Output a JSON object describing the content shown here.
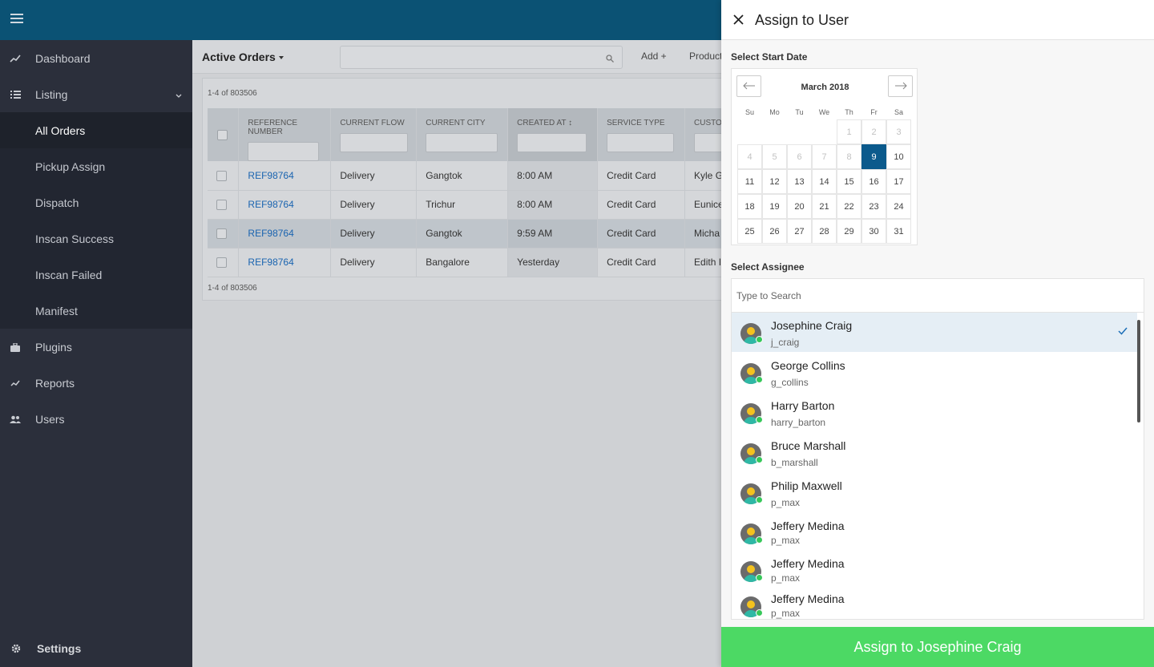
{
  "sidebar": {
    "items": [
      {
        "label": "Dashboard"
      },
      {
        "label": "Listing"
      }
    ],
    "sub_items": [
      {
        "label": "All Orders"
      },
      {
        "label": "Pickup Assign"
      },
      {
        "label": "Dispatch"
      },
      {
        "label": "Inscan Success"
      },
      {
        "label": "Inscan Failed"
      },
      {
        "label": "Manifest"
      }
    ],
    "items_after": [
      {
        "label": "Plugins"
      },
      {
        "label": "Reports"
      },
      {
        "label": "Users"
      }
    ],
    "settings_label": "Settings"
  },
  "main": {
    "title": "Active Orders",
    "add_label": "Add +",
    "products_label": "Product",
    "count_top": "1-4 of 803506",
    "count_bottom": "1-4 of 803506",
    "columns": [
      "REFERENCE NUMBER",
      "CURRENT FLOW",
      "CURRENT CITY",
      "CREATED AT",
      "SERVICE TYPE",
      "CUSTO"
    ],
    "rows": [
      {
        "ref": "REF98764",
        "flow": "Delivery",
        "city": "Gangtok",
        "created": "8:00 AM",
        "service": "Credit Card",
        "customer": "Kyle G"
      },
      {
        "ref": "REF98764",
        "flow": "Delivery",
        "city": "Trichur",
        "created": "8:00 AM",
        "service": "Credit Card",
        "customer": "Eunice"
      },
      {
        "ref": "REF98764",
        "flow": "Delivery",
        "city": "Gangtok",
        "created": "9:59 AM",
        "service": "Credit Card",
        "customer": "Micha"
      },
      {
        "ref": "REF98764",
        "flow": "Delivery",
        "city": "Bangalore",
        "created": "Yesterday",
        "service": "Credit Card",
        "customer": "Edith I"
      }
    ]
  },
  "drawer": {
    "title": "Assign to User",
    "start_date_label": "Select Start Date",
    "calendar": {
      "month": "March 2018",
      "dow": [
        "Su",
        "Mo",
        "Tu",
        "We",
        "Th",
        "Fr",
        "Sa"
      ],
      "prev_days": [
        "1",
        "2",
        "3",
        "4",
        "5",
        "6",
        "7",
        "8"
      ],
      "selected_day": "9",
      "days": [
        "10",
        "11",
        "12",
        "13",
        "14",
        "15",
        "16",
        "17",
        "18",
        "19",
        "20",
        "21",
        "22",
        "23",
        "24",
        "25",
        "26",
        "27",
        "28",
        "29",
        "30",
        "31"
      ]
    },
    "assignee_label": "Select Assignee",
    "search_placeholder": "Type to Search",
    "users": [
      {
        "name": "Josephine Craig",
        "handle": "j_craig"
      },
      {
        "name": "George Collins",
        "handle": "g_collins"
      },
      {
        "name": "Harry Barton",
        "handle": "harry_barton"
      },
      {
        "name": "Bruce Marshall",
        "handle": "b_marshall"
      },
      {
        "name": "Philip Maxwell",
        "handle": "p_max"
      },
      {
        "name": "Jeffery Medina",
        "handle": "p_max"
      },
      {
        "name": "Jeffery Medina",
        "handle": "p_max"
      },
      {
        "name": "Jeffery Medina",
        "handle": "p_max"
      }
    ],
    "assign_button": "Assign to Josephine Craig"
  },
  "colors": {
    "topbar": "#0b5274",
    "sidebar": "#2b2f3b",
    "selected_day": "#0b5a8c",
    "assign_button": "#4cd964",
    "online": "#37c85a"
  }
}
